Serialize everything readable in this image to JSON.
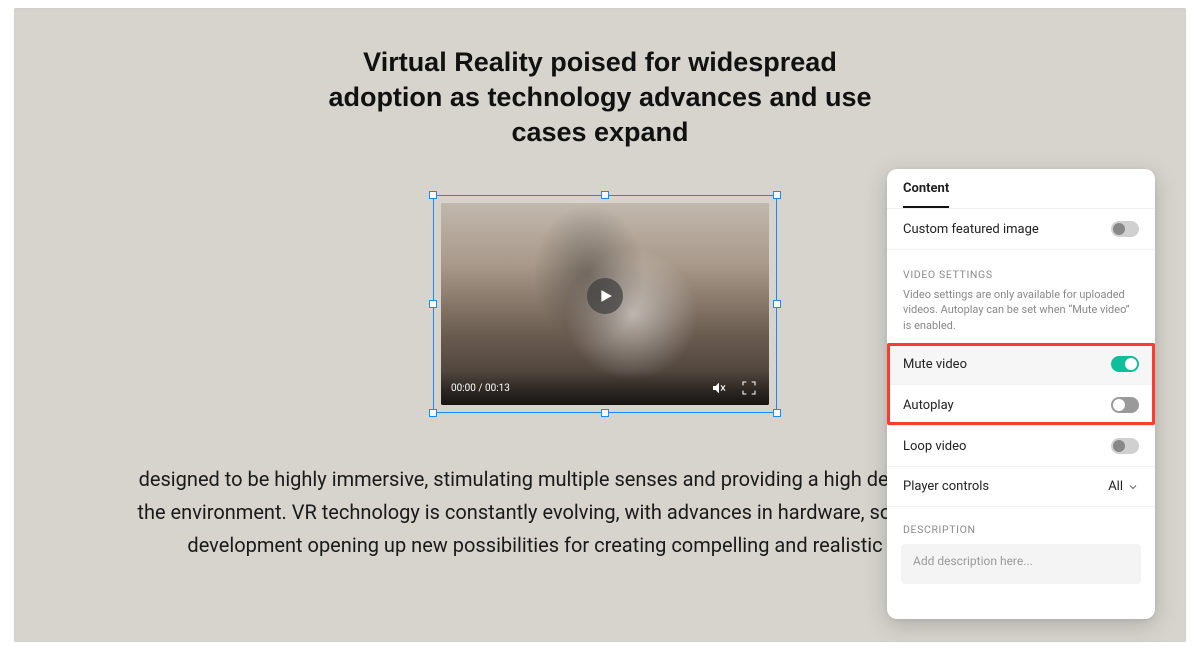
{
  "title": {
    "line1": "Virtual Reality poised for widespread",
    "line2": "adoption as technology advances and use",
    "line3": "cases expand"
  },
  "video": {
    "timecode": "00:00 / 00:13"
  },
  "body_text": "designed to be highly immersive, stimulating multiple senses and providing a high degree of control over the environment. VR technology is constantly evolving, with advances in hardware, software, and content development opening up new possibilities for creating compelling and realistic virtual worlds.",
  "panel": {
    "tab": "Content",
    "featured_image_label": "Custom featured image",
    "video_settings_title": "VIDEO SETTINGS",
    "video_settings_help": "Video settings are only available for uploaded videos. Autoplay can be set when “Mute video” is enabled.",
    "mute_label": "Mute video",
    "autoplay_label": "Autoplay",
    "loop_label": "Loop video",
    "player_controls_label": "Player controls",
    "player_controls_value": "All",
    "description_title": "DESCRIPTION",
    "description_placeholder": "Add description here..."
  }
}
